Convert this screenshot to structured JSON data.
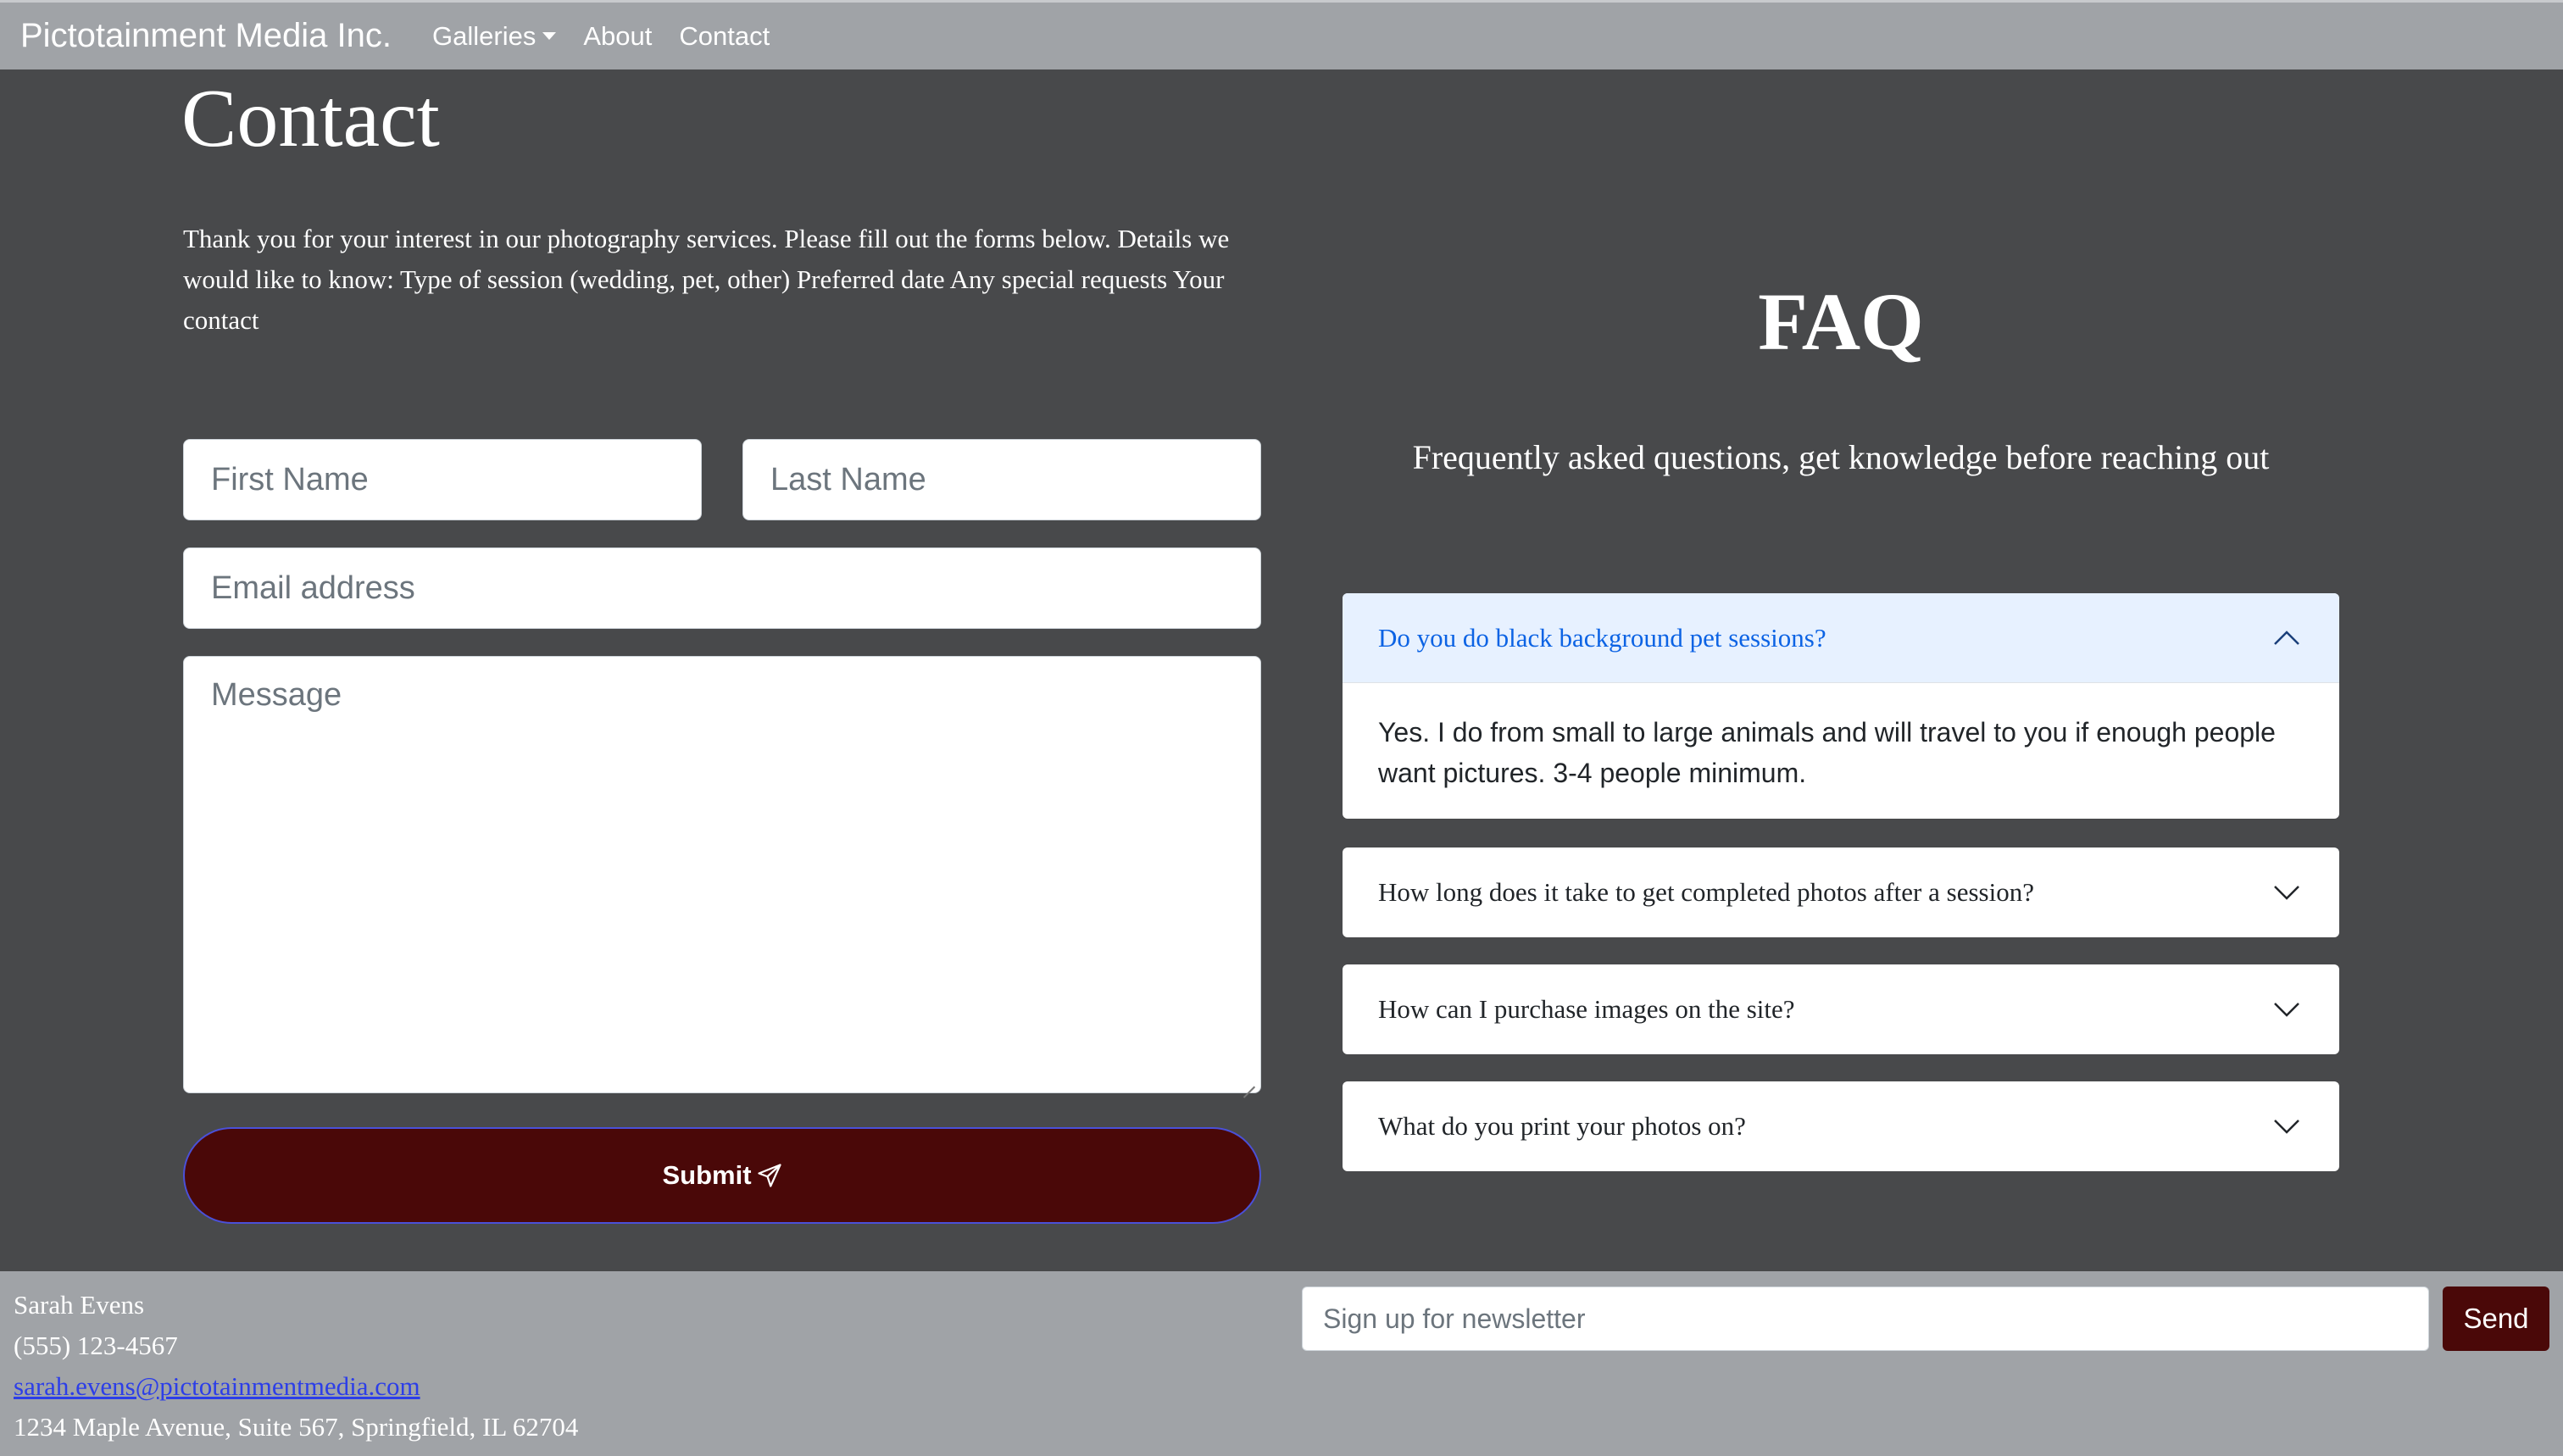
{
  "navbar": {
    "brand": "Pictotainment Media Inc.",
    "items": [
      {
        "label": "Galleries",
        "dropdown": true
      },
      {
        "label": "About"
      },
      {
        "label": "Contact"
      }
    ]
  },
  "contact": {
    "title": "Contact",
    "intro": "Thank you for your interest in our photography services. Please fill out the forms below. Details we would like to know: Type of session (wedding, pet, other) Preferred date Any special requests Your contact",
    "form": {
      "first_name_placeholder": "First Name",
      "last_name_placeholder": "Last Name",
      "email_placeholder": "Email address",
      "message_placeholder": "Message",
      "submit_label": "Submit"
    }
  },
  "faq": {
    "title": "FAQ",
    "subtitle": "Frequently asked questions, get knowledge before reaching out",
    "items": [
      {
        "question": "Do you do black background pet sessions?",
        "answer": "Yes. I do from small to large animals and will travel to you if enough people want pictures. 3-4 people minimum.",
        "expanded": true
      },
      {
        "question": "How long does it take to get completed photos after a session?",
        "expanded": false
      },
      {
        "question": "How can I purchase images on the site?",
        "expanded": false
      },
      {
        "question": "What do you print your photos on?",
        "expanded": false
      }
    ]
  },
  "footer": {
    "name": "Sarah Evens",
    "phone": "(555) 123-4567",
    "email": "sarah.evens@pictotainmentmedia.com",
    "address": "1234 Maple Avenue, Suite 567, Springfield, IL 62704",
    "newsletter_placeholder": "Sign up for newsletter",
    "send_label": "Send"
  },
  "colors": {
    "page_background": "#48494b",
    "navbar_background": "#a0a3a7",
    "button_maroon": "#4a0808",
    "accordion_active_bg": "#e7f1ff",
    "accordion_active_text": "#0c63e4"
  }
}
